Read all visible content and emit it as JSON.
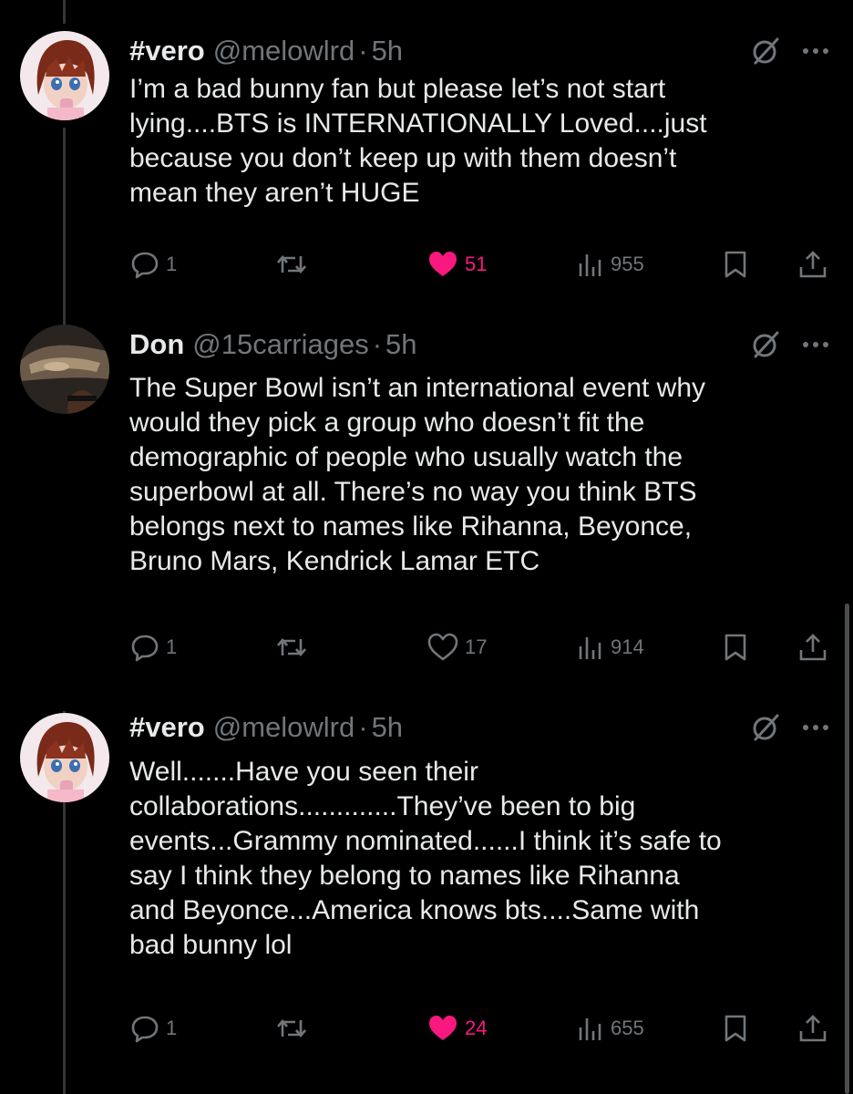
{
  "tweets": [
    {
      "name": "#vero",
      "handle": "@melowlrd",
      "dot": "·",
      "time": "5h",
      "lines": [
        "I’m a bad bunny fan but please let’s not start",
        "lying....BTS is INTERNATIONALLY Loved....just",
        "because you don’t keep up with them doesn’t",
        "mean they aren’t HUGE"
      ],
      "stats": {
        "replies": "1",
        "reposts": "",
        "likes": "51",
        "views": "955"
      },
      "liked": true
    },
    {
      "name": "Don",
      "handle": "@15carriages",
      "dot": "·",
      "time": "5h",
      "lines": [
        "The Super Bowl isn’t an international event why",
        "would they pick a group who doesn’t fit the",
        "demographic of people who usually watch the",
        "superbowl at all. There’s no way you think BTS",
        "belongs next to names like Rihanna, Beyonce,",
        "Bruno Mars, Kendrick Lamar ETC"
      ],
      "stats": {
        "replies": "1",
        "reposts": "",
        "likes": "17",
        "views": "914"
      },
      "liked": false
    },
    {
      "name": "#vero",
      "handle": "@melowlrd",
      "dot": "·",
      "time": "5h",
      "lines": [
        "Well.......Have you seen their",
        "collaborations.............They’ve been to big",
        "events...Grammy nominated......I think it’s safe to",
        "say I think they belong to names like Rihanna",
        "and Beyonce...America knows bts....Same with",
        "bad bunny lol"
      ],
      "stats": {
        "replies": "1",
        "reposts": "",
        "likes": "24",
        "views": "655"
      },
      "liked": true
    }
  ],
  "icons": {
    "reply": "reply-icon",
    "repost": "repost-icon",
    "like": "heart-icon",
    "views": "views-icon",
    "bookmark": "bookmark-icon",
    "share": "share-icon",
    "grok": "grok-icon",
    "more": "more-icon"
  },
  "colors": {
    "background": "#000000",
    "text": "#e7e9ea",
    "secondary": "#71767b",
    "like": "#f91880",
    "thread_line": "#333639"
  }
}
